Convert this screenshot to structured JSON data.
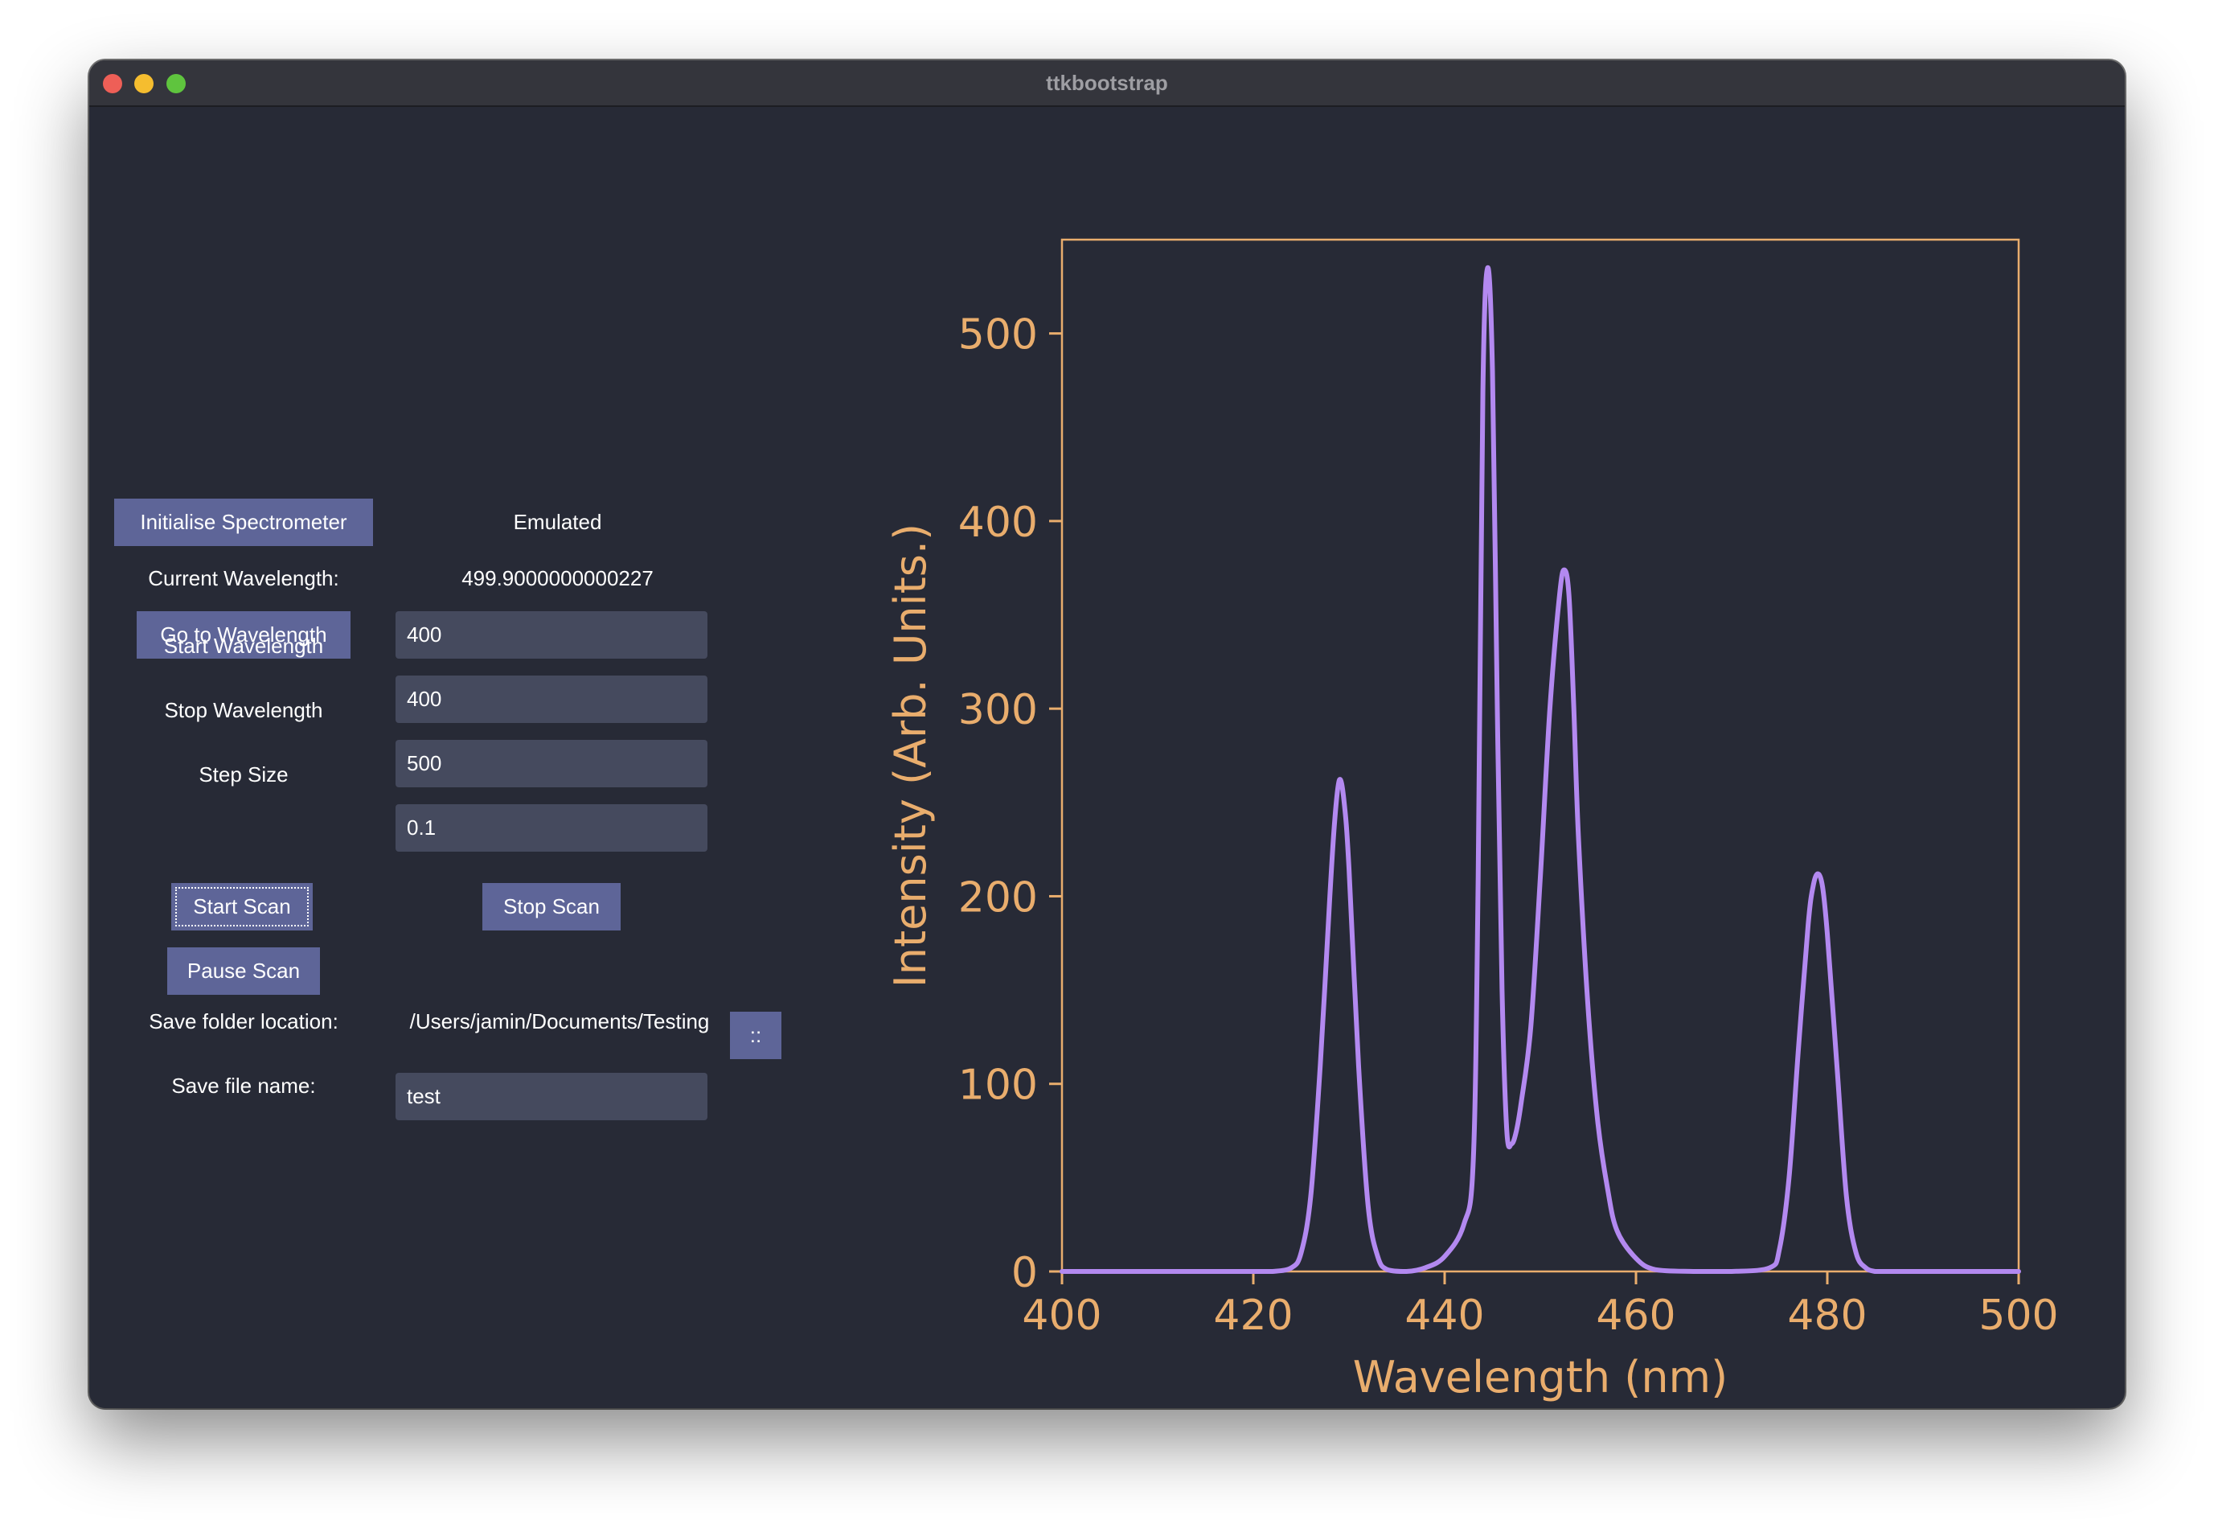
{
  "window": {
    "title": "ttkbootstrap"
  },
  "controls": {
    "init_button": "Initialise Spectrometer",
    "mode_status": "Emulated",
    "current_wavelength_label": "Current Wavelength:",
    "current_wavelength_value": "499.9000000000227",
    "goto_button": "Go to Wavelength",
    "goto_value": "400",
    "start_label": "Start Wavelength",
    "start_value": "400",
    "stop_label": "Stop Wavelength",
    "stop_value": "500",
    "step_label": "Step Size",
    "step_value": "0.1",
    "start_scan_button": "Start Scan",
    "stop_scan_button": "Stop Scan",
    "pause_scan_button": "Pause Scan",
    "save_folder_label": "Save folder location:",
    "save_folder_value": "/Users/jamin/Documents/Testing",
    "browse_button": "::",
    "save_file_label": "Save file name:",
    "save_file_value": "test"
  },
  "colors": {
    "window_bg": "#272a36",
    "accent_button": "#5e6598",
    "entry_bg": "#454a5e",
    "axis": "#e9ad6d",
    "line": "#b389f0"
  },
  "chart_data": {
    "type": "line",
    "xlabel": "Wavelength (nm)",
    "ylabel": "Intensity (Arb. Units.)",
    "xlim": [
      400,
      500
    ],
    "ylim": [
      0,
      550
    ],
    "xticks": [
      400,
      420,
      440,
      460,
      480,
      500
    ],
    "yticks": [
      0,
      100,
      200,
      300,
      400,
      500
    ],
    "grid": false,
    "legend": false,
    "series": [
      {
        "x": [
          400,
          420,
          422,
          424,
          425,
          426,
          427,
          428,
          428.5,
          429,
          429.5,
          430,
          431,
          432,
          433,
          434,
          436,
          438,
          440,
          442,
          443,
          443.5,
          444,
          444.5,
          445,
          445.5,
          446,
          446.5,
          447,
          447.5,
          448,
          449,
          450,
          451,
          452,
          452.5,
          453,
          453.5,
          454,
          455,
          456,
          457,
          458,
          460,
          462,
          466,
          470,
          474,
          475,
          476,
          477,
          478,
          478.5,
          479,
          479.5,
          480,
          481,
          482,
          483,
          484,
          485,
          486,
          490,
          500
        ],
        "y": [
          0,
          0,
          0,
          2,
          10,
          40,
          110,
          200,
          240,
          262,
          250,
          215,
          110,
          35,
          8,
          1,
          0,
          2,
          8,
          25,
          60,
          210,
          470,
          535,
          480,
          300,
          150,
          75,
          68,
          75,
          90,
          130,
          210,
          300,
          360,
          374,
          360,
          300,
          230,
          140,
          80,
          45,
          22,
          7,
          1,
          0,
          0,
          2,
          12,
          50,
          120,
          185,
          205,
          212,
          205,
          180,
          110,
          40,
          10,
          2,
          0,
          0,
          0,
          0
        ]
      }
    ]
  }
}
